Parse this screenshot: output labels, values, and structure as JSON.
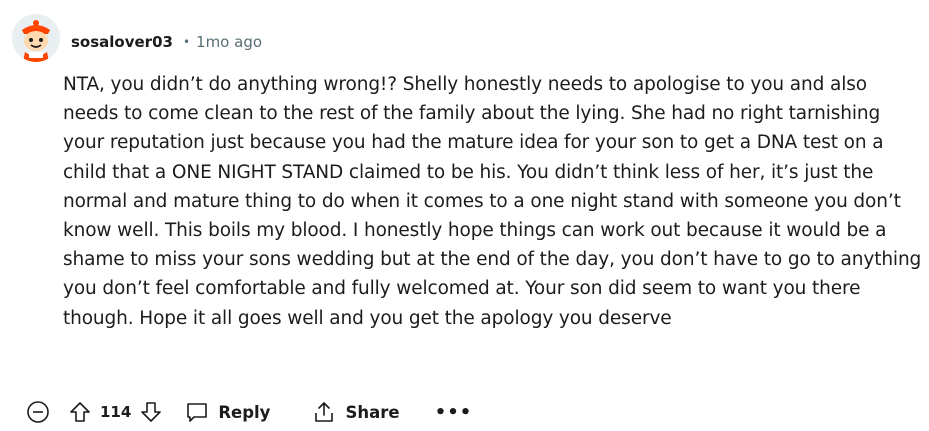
{
  "comment": {
    "author": "sosalover03",
    "separator": "•",
    "timestamp": "1mo ago",
    "body": "NTA, you didn’t do anything wrong!? Shelly honestly needs to apologise to you and also needs to come clean to the rest of the family about the lying. She had no right tarnishing your reputation just because you had the mature idea for your son to get a DNA test on a child that a ONE NIGHT STAND claimed to be his. You didn’t think less of her, it’s just the normal and mature thing to do when it comes to a one night stand with someone you don’t know well. This boils my blood. I honestly hope things can work out because it would be a shame to miss your sons wedding but at the end of the day, you don’t have to go to anything you don’t feel comfortable and fully welcomed at. Your son did seem to want you there though. Hope it all goes well and you get the apology you deserve"
  },
  "actions": {
    "collapse_icon": "collapse-minus-icon",
    "upvote_icon": "upvote-arrow-icon",
    "score": "114",
    "downvote_icon": "downvote-arrow-icon",
    "reply_icon": "speech-bubble-icon",
    "reply_label": "Reply",
    "share_icon": "share-icon",
    "share_label": "Share",
    "more_label": "•••"
  },
  "colors": {
    "text": "#1c1c1c",
    "meta": "#576f76",
    "avatar_bg": "#e9eef0",
    "avatar_accent": "#ff4500"
  }
}
